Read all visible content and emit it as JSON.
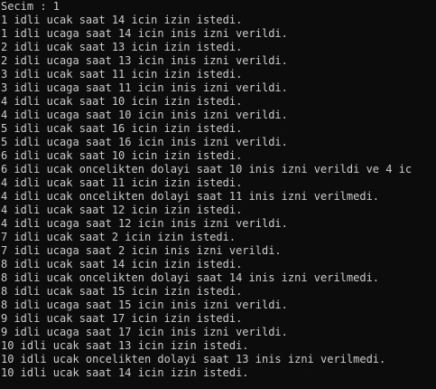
{
  "colors": {
    "background": "#0c0c0c",
    "text": "#cccccc"
  },
  "console": {
    "lines": [
      "Secim : 1",
      "1 idli ucak saat 14 icin izin istedi.",
      "1 idli ucaga saat 14 icin inis izni verildi.",
      "2 idli ucak saat 13 icin izin istedi.",
      "2 idli ucaga saat 13 icin inis izni verildi.",
      "3 idli ucak saat 11 icin izin istedi.",
      "3 idli ucaga saat 11 icin inis izni verildi.",
      "4 idli ucak saat 10 icin izin istedi.",
      "4 idli ucaga saat 10 icin inis izni verildi.",
      "5 idli ucak saat 16 icin izin istedi.",
      "5 idli ucaga saat 16 icin inis izni verildi.",
      "6 idli ucak saat 10 icin izin istedi.",
      "6 idli ucak oncelikten dolayi saat 10 inis izni verildi ve 4 ic",
      "4 idli ucak saat 11 icin izin istedi.",
      "4 idli ucak oncelikten dolayi saat 11 inis izni verilmedi.",
      "4 idli ucak saat 12 icin izin istedi.",
      "4 idli ucaga saat 12 icin inis izni verildi.",
      "7 idli ucak saat 2 icin izin istedi.",
      "7 idli ucaga saat 2 icin inis izni verildi.",
      "8 idli ucak saat 14 icin izin istedi.",
      "8 idli ucak oncelikten dolayi saat 14 inis izni verilmedi.",
      "8 idli ucak saat 15 icin izin istedi.",
      "8 idli ucaga saat 15 icin inis izni verildi.",
      "9 idli ucak saat 17 icin izin istedi.",
      "9 idli ucaga saat 17 icin inis izni verildi.",
      "10 idli ucak saat 13 icin izin istedi.",
      "10 idli ucak oncelikten dolayi saat 13 inis izni verilmedi.",
      "10 idli ucak saat 14 icin izin istedi."
    ]
  }
}
